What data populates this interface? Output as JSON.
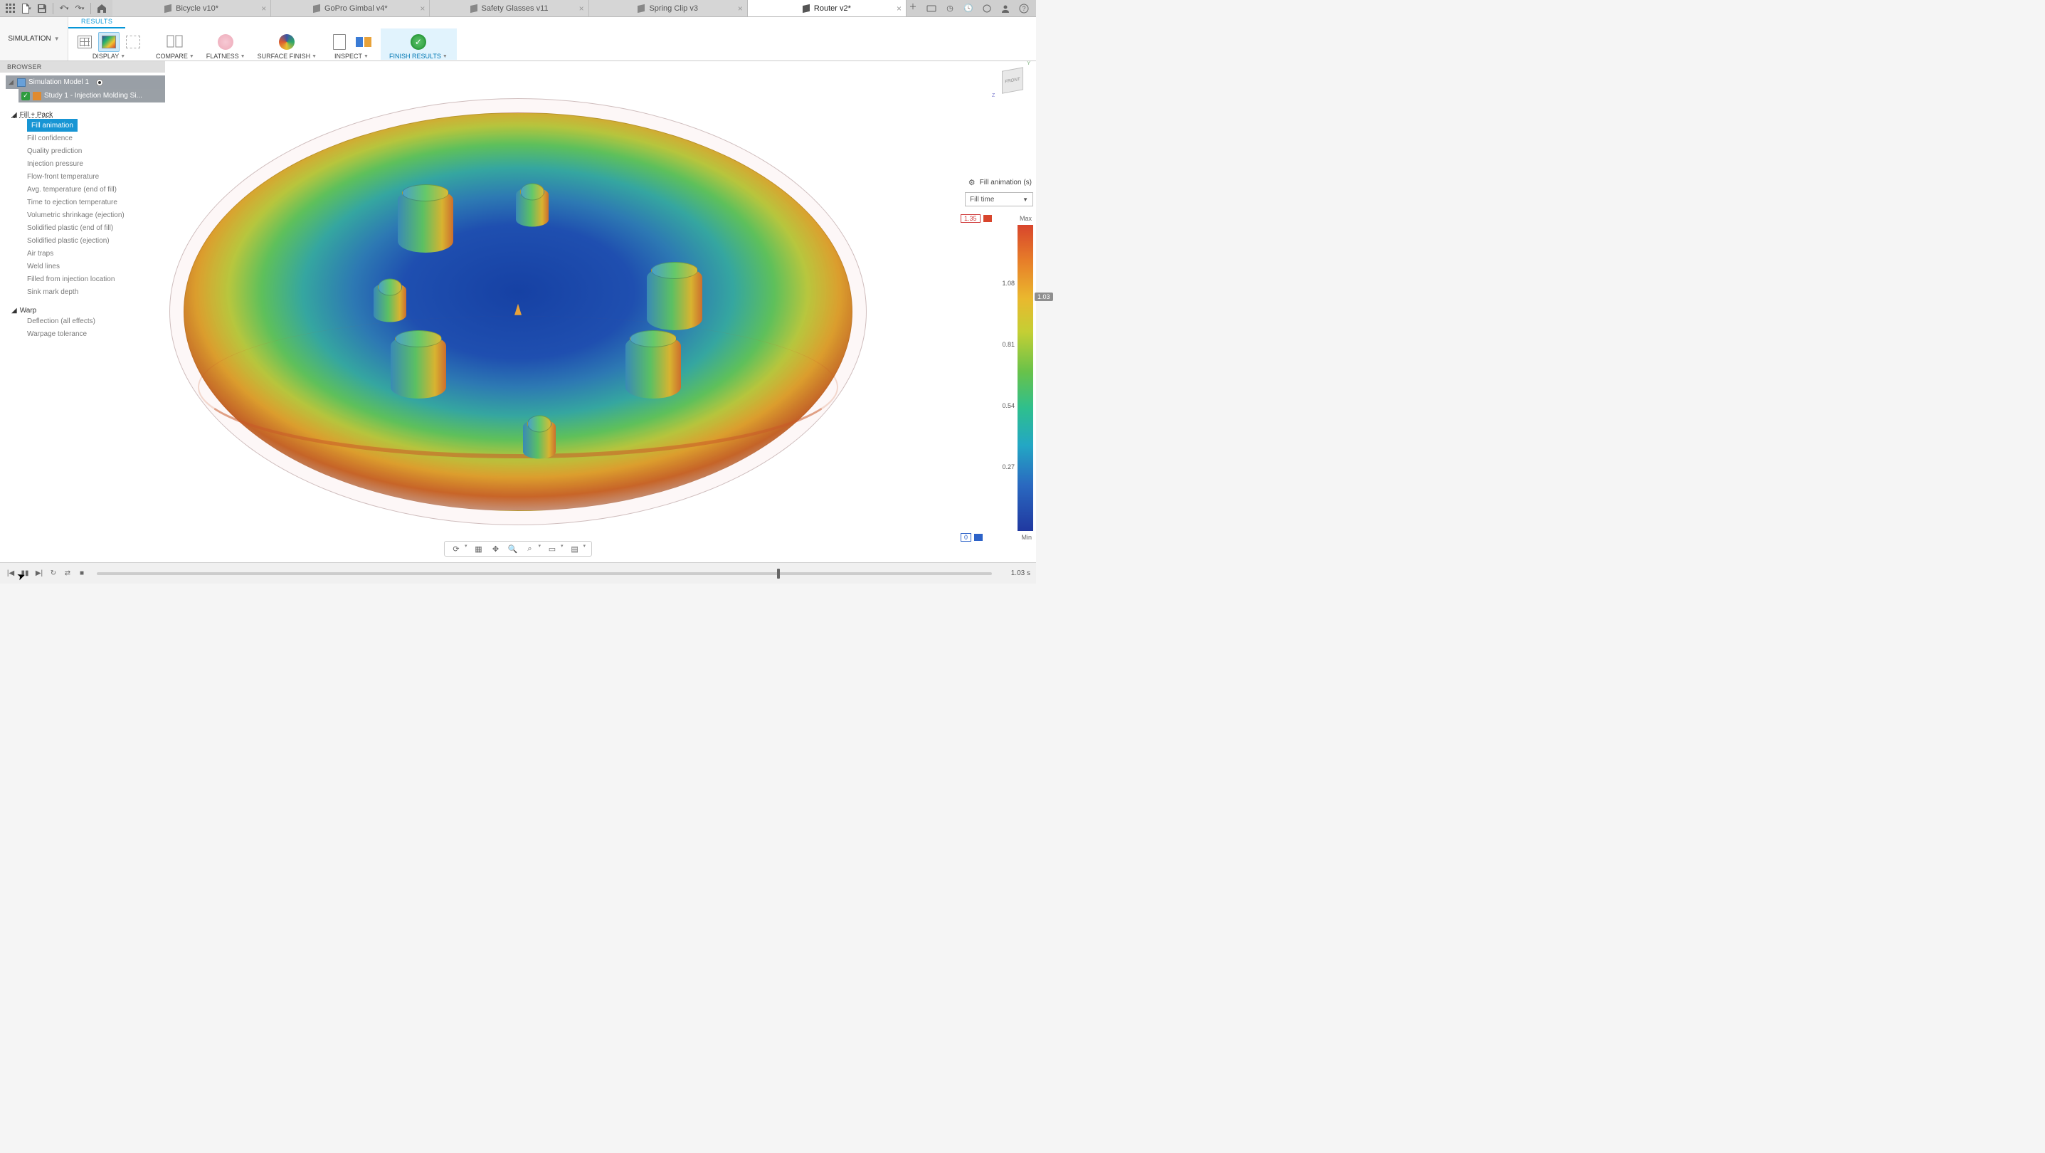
{
  "tabs": [
    {
      "label": "Bicycle v10*",
      "active": false
    },
    {
      "label": "GoPro Gimbal v4*",
      "active": false
    },
    {
      "label": "Safety Glasses v11",
      "active": false
    },
    {
      "label": "Spring Clip v3",
      "active": false
    },
    {
      "label": "Router v2*",
      "active": true
    }
  ],
  "workspace_button": "SIMULATION",
  "ribbon": {
    "tab": "RESULTS",
    "groups": {
      "display": "DISPLAY",
      "compare": "COMPARE",
      "flatness": "FLATNESS",
      "surface": "SURFACE FINISH",
      "inspect": "INSPECT",
      "finish": "FINISH RESULTS"
    }
  },
  "browser": {
    "title": "BROWSER",
    "model": "Simulation Model 1",
    "study": "Study 1 - Injection Molding Si...",
    "groups": {
      "fill_pack": "Fill + Pack",
      "warp": "Warp"
    },
    "results": [
      "Fill animation",
      "Fill confidence",
      "Quality prediction",
      "Injection pressure",
      "Flow-front temperature",
      "Avg. temperature (end of fill)",
      "Time to ejection temperature",
      "Volumetric shrinkage (ejection)",
      "Solidified plastic (end of fill)",
      "Solidified plastic (ejection)",
      "Air traps",
      "Weld lines",
      "Filled from injection location",
      "Sink mark depth"
    ],
    "warp_results": [
      "Deflection (all effects)",
      "Warpage tolerance"
    ]
  },
  "legend": {
    "title": "Fill animation (s)",
    "mode": "Fill time",
    "max_val": "1.35",
    "max_lbl": "Max",
    "min_val": "0",
    "min_lbl": "Min",
    "current": "1.03",
    "ticks": [
      "1.08",
      "0.81",
      "0.54",
      "0.27"
    ]
  },
  "viewcube": {
    "face": "FRONT"
  },
  "timeline": {
    "current": "1.03 s",
    "progress_pct": 76
  },
  "chart_data": {
    "type": "colorbar",
    "title": "Fill animation (s)",
    "variable": "Fill time",
    "min": 0,
    "max": 1.35,
    "current": 1.03,
    "ticks": [
      0,
      0.27,
      0.54,
      0.81,
      1.08,
      1.35
    ],
    "colormap": [
      "#2038a0",
      "#2a69c0",
      "#23a7c4",
      "#2ebf8e",
      "#68c24a",
      "#c4cf34",
      "#eab82e",
      "#e77f29",
      "#d8452c"
    ]
  }
}
